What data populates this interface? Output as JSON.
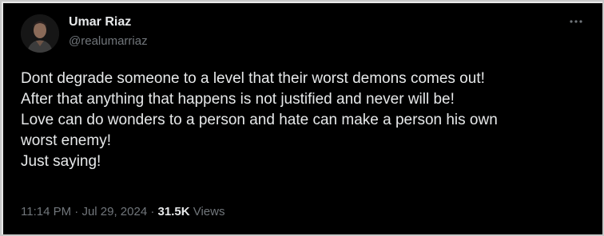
{
  "user": {
    "display_name": "Umar Riaz",
    "handle": "@realumarriaz"
  },
  "more_icon": "more-horizontal-icon",
  "tweet": {
    "lines": [
      "Dont degrade someone to a level that their worst demons comes out!",
      "After that anything that happens is not justified and never will be!",
      "Love can do wonders to a person and hate can make a person his own",
      "worst enemy!",
      "Just saying!"
    ]
  },
  "meta": {
    "time": "11:14 PM",
    "separator": "·",
    "date": "Jul 29, 2024",
    "views_count": "31.5K",
    "views_label": "Views"
  },
  "colors": {
    "background": "#000000",
    "text": "#e7e9ea",
    "secondary_text": "#71767b"
  }
}
